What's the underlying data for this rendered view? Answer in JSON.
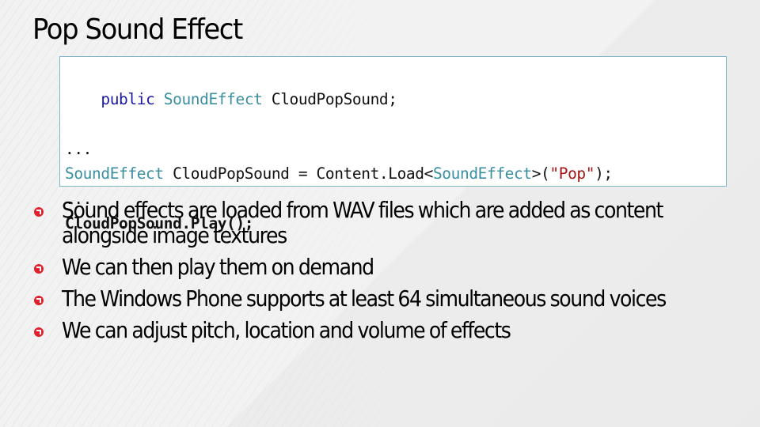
{
  "slide": {
    "title": "Pop Sound Effect",
    "colors": {
      "bullet": "#e0202e",
      "keyword": "#1a1aa6",
      "type": "#3a8fa0",
      "string": "#a31515",
      "code_border": "#7fb8c4"
    }
  },
  "code": {
    "lines": [
      {
        "segments": [
          {
            "text": "public",
            "style": "keyword"
          },
          {
            "text": " ",
            "style": "plain"
          },
          {
            "text": "SoundEffect",
            "style": "type"
          },
          {
            "text": " CloudPopSound;",
            "style": "plain"
          }
        ],
        "bold": false
      },
      {
        "segments": [
          {
            "text": "...",
            "style": "plain"
          }
        ],
        "bold": false
      },
      {
        "segments": [
          {
            "text": "SoundEffect",
            "style": "type"
          },
          {
            "text": " CloudPopSound = Content.Load<",
            "style": "plain"
          },
          {
            "text": "SoundEffect",
            "style": "type"
          },
          {
            "text": ">(",
            "style": "plain"
          },
          {
            "text": "\"Pop\"",
            "style": "string"
          },
          {
            "text": ");",
            "style": "plain"
          }
        ],
        "bold": false
      },
      {
        "segments": [
          {
            "text": "...",
            "style": "plain"
          }
        ],
        "bold": false
      },
      {
        "segments": [
          {
            "text": "CloudPopSound.Play();",
            "style": "plain"
          }
        ],
        "bold": true
      }
    ]
  },
  "bullets": [
    {
      "text": "Sound effects are loaded from WAV files which are added as content alongside image textures",
      "icon": "bullet-arrow-icon"
    },
    {
      "text": "We can then play them on demand",
      "icon": "bullet-arrow-icon"
    },
    {
      "text": "The Windows Phone supports at least 64 simultaneous sound voices",
      "icon": "bullet-arrow-icon"
    },
    {
      "text": "We can adjust pitch, location and volume of effects",
      "icon": "bullet-arrow-icon"
    }
  ]
}
